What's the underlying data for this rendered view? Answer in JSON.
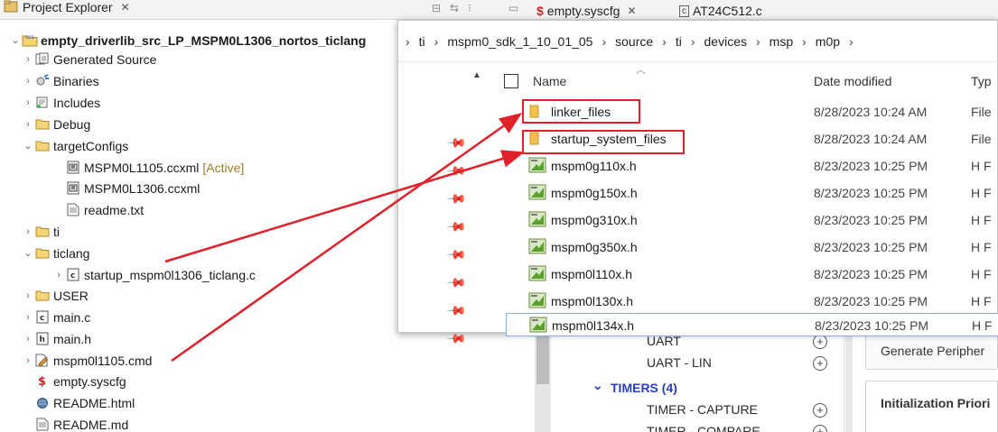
{
  "project_explorer": {
    "tab_label": "Project Explorer",
    "close_glyph": "✕",
    "tree": [
      {
        "label": "empty_driverlib_src_LP_MSPM0L1306_nortos_ticlang",
        "icon": "ccs-project-icon",
        "chevron": "expanded",
        "level": 0,
        "bold": true
      },
      {
        "label": "Generated Source",
        "icon": "generated-source-icon",
        "chevron": "collapsed",
        "level": 1
      },
      {
        "label": "Binaries",
        "icon": "binaries-icon",
        "chevron": "collapsed",
        "level": 1
      },
      {
        "label": "Includes",
        "icon": "includes-icon",
        "chevron": "collapsed",
        "level": 1
      },
      {
        "label": "Debug",
        "icon": "folder-icon",
        "chevron": "collapsed",
        "level": 1
      },
      {
        "label": "targetConfigs",
        "icon": "folder-icon",
        "chevron": "expanded",
        "level": 1
      },
      {
        "label": "MSPM0L1105.ccxml",
        "icon": "ccxml-file-icon",
        "chevron": "none",
        "level": 2,
        "tag": "[Active]"
      },
      {
        "label": "MSPM0L1306.ccxml",
        "icon": "ccxml-file-icon",
        "chevron": "none",
        "level": 2
      },
      {
        "label": "readme.txt",
        "icon": "text-file-icon",
        "chevron": "none",
        "level": 2
      },
      {
        "label": "ti",
        "icon": "folder-icon",
        "chevron": "collapsed",
        "level": 1
      },
      {
        "label": "ticlang",
        "icon": "folder-icon",
        "chevron": "expanded",
        "level": 1
      },
      {
        "label": "startup_mspm0l1306_ticlang.c",
        "icon": "c-file-icon",
        "chevron": "collapsed",
        "level": 2
      },
      {
        "label": "USER",
        "icon": "folder-icon",
        "chevron": "collapsed",
        "level": 1
      },
      {
        "label": "main.c",
        "icon": "c-file-icon",
        "chevron": "collapsed",
        "level": 1
      },
      {
        "label": "main.h",
        "icon": "h-file-icon",
        "chevron": "collapsed",
        "level": 1
      },
      {
        "label": "mspm0l1105.cmd",
        "icon": "cmd-file-icon",
        "chevron": "collapsed",
        "level": 1
      },
      {
        "label": "empty.syscfg",
        "icon": "syscfg-icon",
        "chevron": "none",
        "level": 1
      },
      {
        "label": "README.html",
        "icon": "html-file-icon",
        "chevron": "none",
        "level": 1
      },
      {
        "label": "README.md",
        "icon": "md-file-icon",
        "chevron": "none",
        "level": 1
      }
    ]
  },
  "editor_tabs": {
    "tab1": "empty.syscfg",
    "tab1_close": "✕",
    "tab2": "AT24C512.c"
  },
  "file_explorer": {
    "breadcrumb": [
      "ti",
      "mspm0_sdk_1_10_01_05",
      "source",
      "ti",
      "devices",
      "msp",
      "m0p"
    ],
    "breadcrumb_sep": "›",
    "columns": {
      "name": "Name",
      "date": "Date modified",
      "type": "Typ"
    },
    "files": [
      {
        "name": "linker_files",
        "date": "8/28/2023 10:24 AM",
        "type": "File",
        "kind": "folder",
        "highlighted": true
      },
      {
        "name": "startup_system_files",
        "date": "8/28/2023 10:24 AM",
        "type": "File",
        "kind": "folder",
        "highlighted": true
      },
      {
        "name": "mspm0g110x.h",
        "date": "8/23/2023 10:25 PM",
        "type": "H F",
        "kind": "header"
      },
      {
        "name": "mspm0g150x.h",
        "date": "8/23/2023 10:25 PM",
        "type": "H F",
        "kind": "header"
      },
      {
        "name": "mspm0g310x.h",
        "date": "8/23/2023 10:25 PM",
        "type": "H F",
        "kind": "header"
      },
      {
        "name": "mspm0g350x.h",
        "date": "8/23/2023 10:25 PM",
        "type": "H F",
        "kind": "header"
      },
      {
        "name": "mspm0l110x.h",
        "date": "8/23/2023 10:25 PM",
        "type": "H F",
        "kind": "header"
      },
      {
        "name": "mspm0l130x.h",
        "date": "8/23/2023 10:25 PM",
        "type": "H F",
        "kind": "header"
      },
      {
        "name": "mspm0l134x.h",
        "date": "8/23/2023 10:25 PM",
        "type": "H F",
        "kind": "header",
        "selected": true
      }
    ]
  },
  "configurator": {
    "items": [
      {
        "label": "UART",
        "kind": "item"
      },
      {
        "label": "UART - LIN",
        "kind": "item"
      },
      {
        "label": "TIMERS (4)",
        "kind": "section"
      },
      {
        "label": "TIMER - CAPTURE",
        "kind": "item"
      },
      {
        "label": "TIMER - COMPARE",
        "kind": "item"
      }
    ],
    "plus_glyph": "+",
    "generate_button": "Generate Peripher",
    "init_priority": "Initialization Priori"
  },
  "colors": {
    "highlight": "#e0202a",
    "folder": "#f2c14e",
    "section_blue": "#2b3fc4"
  }
}
